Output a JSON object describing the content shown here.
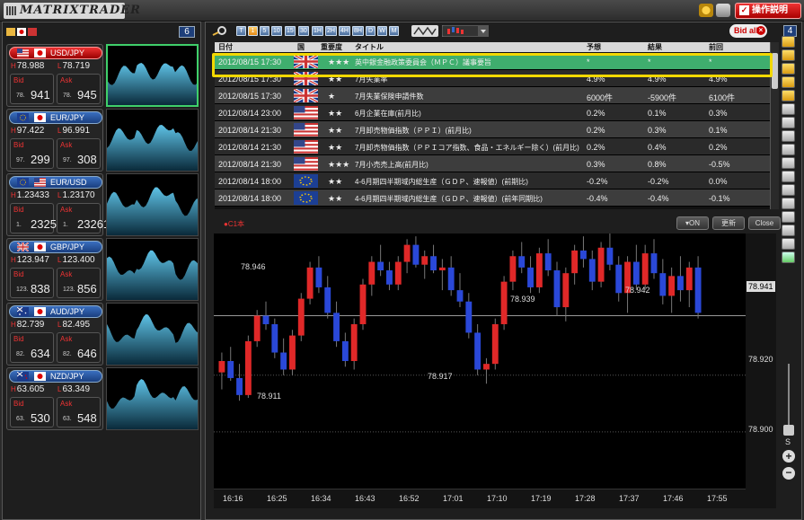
{
  "app": {
    "title": "MATRIXTRADER",
    "help_label": "操作説明"
  },
  "pairs_panel": {
    "count": "6",
    "pairs": [
      {
        "name": "USD/JPY",
        "active": true,
        "high": "78.988",
        "low": "78.719",
        "bid_small": "78.",
        "bid_big": "941",
        "ask_small": "78.",
        "ask_big": "945",
        "flags": [
          "us",
          "jp"
        ]
      },
      {
        "name": "EUR/JPY",
        "active": false,
        "high": "97.422",
        "low": "96.991",
        "bid_small": "97.",
        "bid_big": "299",
        "ask_small": "97.",
        "ask_big": "308",
        "flags": [
          "eu",
          "jp"
        ]
      },
      {
        "name": "EUR/USD",
        "active": false,
        "high": "1.23433",
        "low": "1.23170",
        "bid_small": "1.",
        "bid_big": "23254",
        "ask_small": "1.",
        "ask_big": "23261",
        "flags": [
          "eu",
          "us"
        ]
      },
      {
        "name": "GBP/JPY",
        "active": false,
        "high": "123.947",
        "low": "123.400",
        "bid_small": "123.",
        "bid_big": "838",
        "ask_small": "123.",
        "ask_big": "856",
        "flags": [
          "gb",
          "jp"
        ]
      },
      {
        "name": "AUD/JPY",
        "active": false,
        "high": "82.739",
        "low": "82.495",
        "bid_small": "82.",
        "bid_big": "634",
        "ask_small": "82.",
        "ask_big": "646",
        "flags": [
          "au",
          "jp"
        ]
      },
      {
        "name": "NZD/JPY",
        "active": false,
        "high": "63.605",
        "low": "63.349",
        "bid_small": "63.",
        "bid_big": "530",
        "ask_small": "63.",
        "ask_big": "548",
        "flags": [
          "nz",
          "jp"
        ]
      }
    ],
    "labels": {
      "high": "H",
      "low": "L",
      "bid": "Bid",
      "ask": "Ask"
    }
  },
  "toolbar": {
    "timeframes": [
      "T",
      "1",
      "5",
      "10",
      "15",
      "30",
      "1H",
      "2H",
      "4H",
      "8H",
      "D",
      "W",
      "M"
    ],
    "selected_timeframe": "1",
    "bid_all_label": "Bid all",
    "panel_number": "4"
  },
  "news": {
    "columns": [
      "日付",
      "国",
      "重要度",
      "タイトル",
      "予想",
      "結果",
      "前回"
    ],
    "rows": [
      {
        "date": "2012/08/15 17:30",
        "country": "gb",
        "importance": "★★★",
        "title": "英中銀金融政策委員会（ＭＰＣ）議事要旨",
        "forecast": "*",
        "result": "*",
        "previous": "*",
        "highlighted": true
      },
      {
        "date": "2012/08/15 17:30",
        "country": "gb",
        "importance": "★★",
        "title": "7月失業率",
        "forecast": "4.9%",
        "result": "4.9%",
        "previous": "4.9%"
      },
      {
        "date": "2012/08/15 17:30",
        "country": "gb",
        "importance": "★",
        "title": "7月失業保険申請件数",
        "forecast": "6000件",
        "result": "-5900件",
        "previous": "6100件"
      },
      {
        "date": "2012/08/14 23:00",
        "country": "us",
        "importance": "★★",
        "title": "6月企業在庫(前月比)",
        "forecast": "0.2%",
        "result": "0.1%",
        "previous": "0.3%"
      },
      {
        "date": "2012/08/14 21:30",
        "country": "us",
        "importance": "★★",
        "title": "7月卸売物価指数（ＰＰＩ）(前月比)",
        "forecast": "0.2%",
        "result": "0.3%",
        "previous": "0.1%"
      },
      {
        "date": "2012/08/14 21:30",
        "country": "us",
        "importance": "★★",
        "title": "7月卸売物価指数（ＰＰＩコア指数、食品・エネルギー除く）(前月比)",
        "forecast": "0.2%",
        "result": "0.4%",
        "previous": "0.2%"
      },
      {
        "date": "2012/08/14 21:30",
        "country": "us",
        "importance": "★★★",
        "title": "7月小売売上高(前月比)",
        "forecast": "0.3%",
        "result": "0.8%",
        "previous": "-0.5%"
      },
      {
        "date": "2012/08/14 18:00",
        "country": "eu",
        "importance": "★★",
        "title": "4-6月期四半期域内総生産（ＧＤＰ、速報値）(前期比)",
        "forecast": "-0.2%",
        "result": "-0.2%",
        "previous": "0.0%"
      },
      {
        "date": "2012/08/14 18:00",
        "country": "eu",
        "importance": "★★",
        "title": "4-6月期四半期域内総生産（ＧＤＰ、速報値）(前年同期比)",
        "forecast": "-0.4%",
        "result": "-0.4%",
        "previous": "-0.1%"
      }
    ]
  },
  "chart_controls": {
    "legend": "●C1本",
    "on_label": "▾ON",
    "refresh_label": "更新",
    "close_label": "Close"
  },
  "chart_data": {
    "type": "candlestick",
    "x_ticks": [
      "16:16",
      "16:25",
      "16:34",
      "16:43",
      "16:52",
      "17:01",
      "17:10",
      "17:19",
      "17:28",
      "17:37",
      "17:46",
      "17:55"
    ],
    "y_ticks": [
      "78.920",
      "78.900"
    ],
    "current_price": "78.941",
    "annotations": [
      "78.946",
      "78.911",
      "78.917",
      "78.939",
      "78.942"
    ],
    "ylim": [
      78.88,
      78.97
    ],
    "colors": {
      "up": "#e02828",
      "down": "#2a48d8"
    },
    "candles": [
      [
        78.921,
        78.928,
        78.915,
        78.925
      ],
      [
        78.925,
        78.93,
        78.918,
        78.919
      ],
      [
        78.919,
        78.924,
        78.911,
        78.913
      ],
      [
        78.913,
        78.934,
        78.912,
        78.932
      ],
      [
        78.932,
        78.943,
        78.93,
        78.941
      ],
      [
        78.941,
        78.946,
        78.936,
        78.938
      ],
      [
        78.938,
        78.94,
        78.926,
        78.928
      ],
      [
        78.928,
        78.933,
        78.92,
        78.922
      ],
      [
        78.922,
        78.936,
        78.92,
        78.934
      ],
      [
        78.934,
        78.949,
        78.932,
        78.947
      ],
      [
        78.947,
        78.96,
        78.945,
        78.958
      ],
      [
        78.958,
        78.962,
        78.949,
        78.951
      ],
      [
        78.951,
        78.955,
        78.94,
        78.942
      ],
      [
        78.942,
        78.946,
        78.93,
        78.932
      ],
      [
        78.932,
        78.935,
        78.923,
        78.925
      ],
      [
        78.925,
        78.94,
        78.922,
        78.938
      ],
      [
        78.938,
        78.954,
        78.936,
        78.952
      ],
      [
        78.952,
        78.962,
        78.948,
        78.96
      ],
      [
        78.96,
        78.966,
        78.955,
        78.957
      ],
      [
        78.957,
        78.96,
        78.95,
        78.952
      ],
      [
        78.952,
        78.962,
        78.95,
        78.96
      ],
      [
        78.96,
        78.968,
        78.956,
        78.966
      ],
      [
        78.966,
        78.969,
        78.958,
        78.959
      ],
      [
        78.959,
        78.964,
        78.954,
        78.962
      ],
      [
        78.962,
        78.966,
        78.956,
        78.957
      ],
      [
        78.957,
        78.961,
        78.95,
        78.958
      ],
      [
        78.958,
        78.962,
        78.948,
        78.95
      ],
      [
        78.95,
        78.956,
        78.944,
        78.946
      ],
      [
        78.946,
        78.949,
        78.933,
        78.935
      ],
      [
        78.935,
        78.938,
        78.92,
        78.922
      ],
      [
        78.922,
        78.926,
        78.917,
        78.924
      ],
      [
        78.924,
        78.94,
        78.922,
        78.938
      ],
      [
        78.938,
        78.955,
        78.936,
        78.953
      ],
      [
        78.953,
        78.964,
        78.95,
        78.962
      ],
      [
        78.962,
        78.967,
        78.956,
        78.958
      ],
      [
        78.958,
        78.962,
        78.949,
        78.951
      ],
      [
        78.951,
        78.965,
        78.949,
        78.963
      ],
      [
        78.963,
        78.968,
        78.955,
        78.957
      ],
      [
        78.957,
        78.96,
        78.941,
        78.944
      ],
      [
        78.944,
        78.958,
        78.939,
        78.956
      ],
      [
        78.956,
        78.966,
        78.952,
        78.964
      ],
      [
        78.964,
        78.969,
        78.958,
        78.961
      ],
      [
        78.961,
        78.964,
        78.95,
        78.953
      ],
      [
        78.953,
        78.967,
        78.951,
        78.965
      ],
      [
        78.965,
        78.97,
        78.957,
        78.959
      ],
      [
        78.959,
        78.962,
        78.946,
        78.949
      ],
      [
        78.949,
        78.962,
        78.942,
        78.96
      ],
      [
        78.96,
        78.966,
        78.95,
        78.952
      ],
      [
        78.952,
        78.966,
        78.95,
        78.963
      ],
      [
        78.963,
        78.968,
        78.954,
        78.956
      ],
      [
        78.956,
        78.961,
        78.945,
        78.948
      ],
      [
        78.948,
        78.958,
        78.942,
        78.955
      ],
      [
        78.955,
        78.962,
        78.946,
        78.95
      ],
      [
        78.95,
        78.96,
        78.944,
        78.958
      ],
      [
        78.958,
        78.962,
        78.94,
        78.942
      ]
    ]
  }
}
